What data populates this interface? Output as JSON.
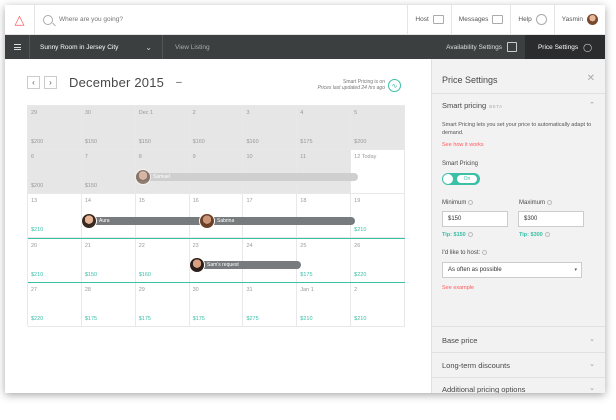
{
  "topnav": {
    "search_placeholder": "Where are you going?",
    "host": "Host",
    "messages": "Messages",
    "help": "Help",
    "user": "Yasmin"
  },
  "toolbar": {
    "room": "Sunny Room in Jersey City",
    "view_listing": "View Listing",
    "availability": "Availability Settings",
    "price_settings": "Price Settings"
  },
  "calendar": {
    "month": "December 2015",
    "smart_status": "Smart Pricing is on",
    "updated": "Prices last updated 24 hrs ago",
    "weeks": [
      [
        {
          "d": "29",
          "p": "$200",
          "past": true
        },
        {
          "d": "30",
          "p": "$150",
          "past": true
        },
        {
          "d": "Dec 1",
          "p": "$150",
          "past": true
        },
        {
          "d": "2",
          "p": "$160",
          "past": true
        },
        {
          "d": "3",
          "p": "$160",
          "past": true
        },
        {
          "d": "4",
          "p": "$175",
          "past": true
        },
        {
          "d": "5",
          "p": "$200",
          "past": true
        }
      ],
      [
        {
          "d": "6",
          "p": "$200",
          "past": true
        },
        {
          "d": "7",
          "p": "$150",
          "past": true
        },
        {
          "d": "8",
          "p": "",
          "past": true
        },
        {
          "d": "9",
          "p": "",
          "past": true
        },
        {
          "d": "10",
          "p": "",
          "past": true
        },
        {
          "d": "11",
          "p": "",
          "past": true
        },
        {
          "d": "12 Today",
          "p": "",
          "past": false
        }
      ],
      [
        {
          "d": "13",
          "p": "$210",
          "past": false
        },
        {
          "d": "14",
          "p": "",
          "past": false
        },
        {
          "d": "15",
          "p": "",
          "past": false
        },
        {
          "d": "16",
          "p": "",
          "past": false
        },
        {
          "d": "17",
          "p": "",
          "past": false
        },
        {
          "d": "18",
          "p": "",
          "past": false
        },
        {
          "d": "19",
          "p": "$210",
          "past": false
        }
      ],
      [
        {
          "d": "20",
          "p": "$210",
          "past": false
        },
        {
          "d": "21",
          "p": "$150",
          "past": false
        },
        {
          "d": "22",
          "p": "$160",
          "past": false
        },
        {
          "d": "23",
          "p": "",
          "past": false
        },
        {
          "d": "24",
          "p": "",
          "past": false
        },
        {
          "d": "25",
          "p": "$175",
          "past": false
        },
        {
          "d": "26",
          "p": "$220",
          "past": false
        }
      ],
      [
        {
          "d": "27",
          "p": "$220",
          "past": false
        },
        {
          "d": "28",
          "p": "$175",
          "past": false
        },
        {
          "d": "29",
          "p": "$175",
          "past": false
        },
        {
          "d": "30",
          "p": "$175",
          "past": false
        },
        {
          "d": "31",
          "p": "$275",
          "past": false
        },
        {
          "d": "Jan 1",
          "p": "$210",
          "past": false
        },
        {
          "d": "2",
          "p": "$210",
          "past": false
        }
      ]
    ],
    "reservations": {
      "samuel": "Samuel",
      "aura": "Aura",
      "sabrina": "Sabrina",
      "sam": "Sam's request"
    }
  },
  "panel": {
    "title": "Price Settings",
    "smart_pricing": "Smart pricing",
    "beta": "BETA",
    "description": "Smart Pricing lets you set your price to automatically adapt to demand.",
    "how_link": "See how it works",
    "smart_label": "Smart Pricing",
    "toggle": "On",
    "minimum_label": "Minimum",
    "maximum_label": "Maximum",
    "minimum": "$150",
    "maximum": "$300",
    "tip_min": "Tip: $150",
    "tip_max": "Tip: $300",
    "host_label": "I'd like to host:",
    "host_option": "As often as possible",
    "example_link": "See example",
    "base_price": "Base price",
    "long_term": "Long-term discounts",
    "additional": "Additional pricing options"
  }
}
